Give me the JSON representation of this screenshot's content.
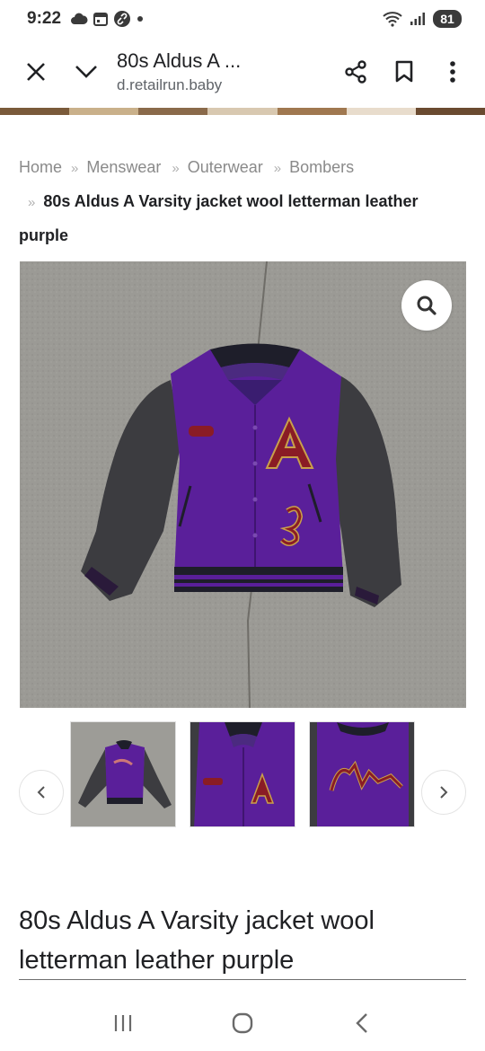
{
  "status_bar": {
    "time": "9:22",
    "battery": "81",
    "icons": [
      "cloud-icon",
      "calendar-icon",
      "link-icon",
      "dot-icon",
      "wifi-icon",
      "signal-icon"
    ]
  },
  "toolbar": {
    "title": "80s Aldus A ...",
    "url": "d.retailrun.baby",
    "icons": [
      "close-icon",
      "chevron-down-icon",
      "share-icon",
      "bookmark-icon",
      "more-vertical-icon"
    ]
  },
  "breadcrumb": {
    "items": [
      "Home",
      "Menswear",
      "Outerwear",
      "Bombers"
    ],
    "current": "80s Aldus A Varsity jacket wool letterman leather purple"
  },
  "product": {
    "title": "80s Aldus A Varsity jacket wool letterman leather purple"
  },
  "colors": {
    "jacket_purple": "#5a1f9a",
    "sleeve_leather": "#3c3c40",
    "patch_red": "#8a1c25",
    "patch_gold": "#c9a04a",
    "concrete": "#9a9994"
  },
  "nav_bar": {
    "icons": [
      "recents-icon",
      "home-icon",
      "back-icon"
    ]
  }
}
